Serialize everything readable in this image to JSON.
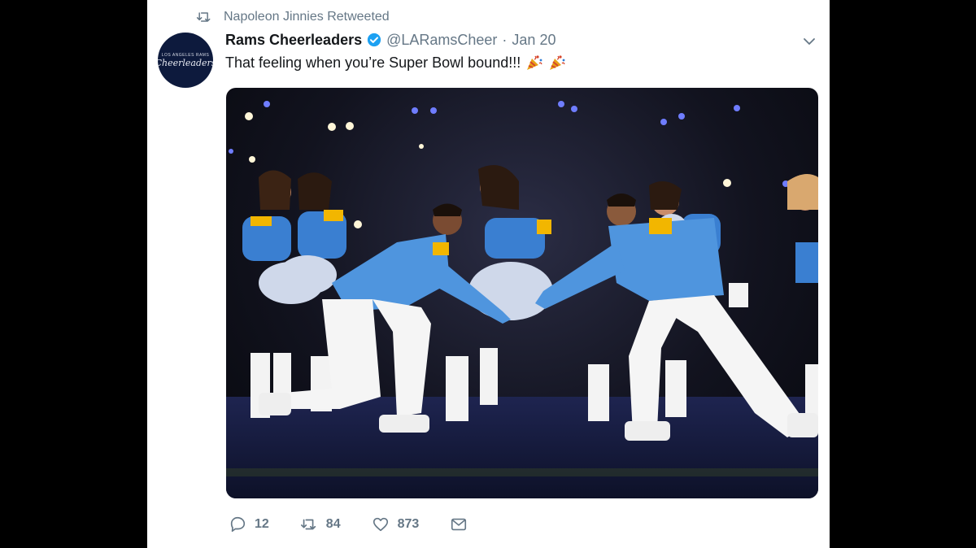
{
  "retweet": {
    "text": "Napoleon Jinnies Retweeted",
    "icon": "retweet-icon"
  },
  "author": {
    "name": "Rams Cheerleaders",
    "handle": "@LARamsCheer",
    "date": "Jan 20",
    "separator": "·",
    "avatar_text": "Cheerleaders",
    "avatar_small_text": "LOS ANGELES RAMS"
  },
  "tweet": {
    "text": "That feeling when you’re Super Bowl bound!!!",
    "emoji": [
      "party-popper",
      "party-popper"
    ]
  },
  "actions": {
    "replies": "12",
    "retweets": "84",
    "likes": "873"
  },
  "colors": {
    "text": "#14171a",
    "muted": "#657786",
    "verified": "#1da1f2",
    "rams_blue": "#3a7fd1",
    "rams_gold": "#f2b600"
  }
}
